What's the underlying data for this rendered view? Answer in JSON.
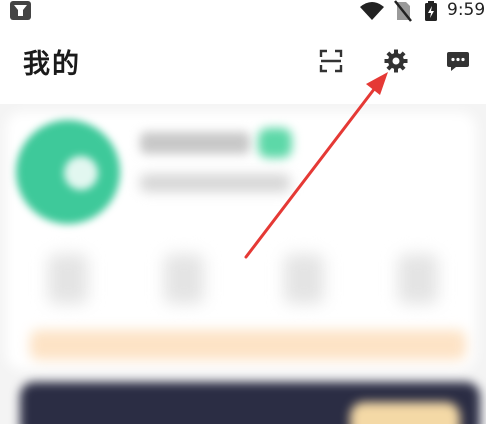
{
  "status_bar": {
    "time": "9:59",
    "left_icon": "app-notification-icon",
    "wifi_icon": "wifi-icon",
    "sim_icon": "no-sim-icon",
    "battery_icon": "battery-charging-icon"
  },
  "header": {
    "title": "我的",
    "scan_icon": "scan-icon",
    "settings_icon": "gear-icon",
    "message_icon": "message-icon"
  },
  "colors": {
    "annotation_arrow": "#e53935",
    "avatar_green": "#3ec99a",
    "banner_dark": "#2b2d44"
  }
}
